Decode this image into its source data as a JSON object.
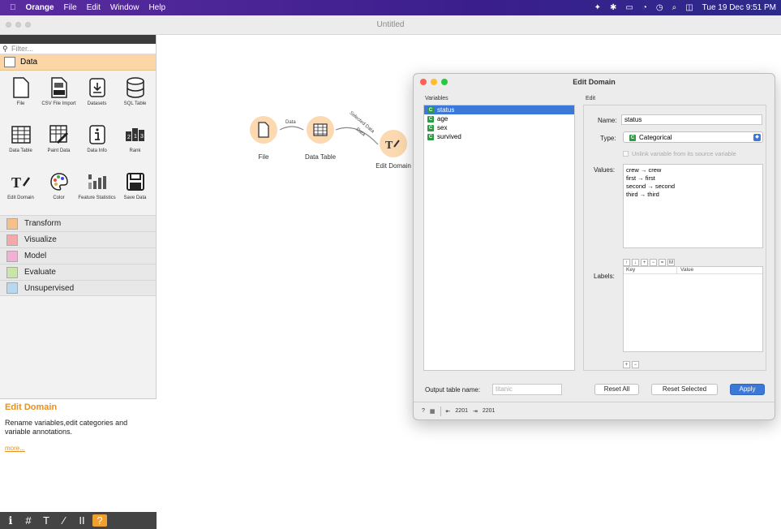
{
  "menubar": {
    "apple": "",
    "app_name": "Orange",
    "menus": [
      "File",
      "Edit",
      "Window",
      "Help"
    ],
    "status_icons": [
      "✦",
      "✱",
      "▭",
      "◔",
      "◷",
      "⌕",
      "◫"
    ],
    "datetime": "Tue 19 Dec 9:51 PM"
  },
  "window": {
    "title": "Untitled"
  },
  "sidebar": {
    "filter_placeholder": "Filter...",
    "data_category": "Data",
    "widgets": [
      {
        "label": "File",
        "icon": "file-icon"
      },
      {
        "label": "CSV File Import",
        "icon": "csv-icon"
      },
      {
        "label": "Datasets",
        "icon": "datasets-icon"
      },
      {
        "label": "SQL Table",
        "icon": "database-icon"
      },
      {
        "label": "Data Table",
        "icon": "table-icon"
      },
      {
        "label": "Paint Data",
        "icon": "paint-data-icon"
      },
      {
        "label": "Data Info",
        "icon": "info-icon"
      },
      {
        "label": "Rank",
        "icon": "rank-icon"
      },
      {
        "label": "Edit Domain",
        "icon": "edit-domain-icon"
      },
      {
        "label": "Color",
        "icon": "palette-icon"
      },
      {
        "label": "Feature Statistics",
        "icon": "bar-chart-icon"
      },
      {
        "label": "Save Data",
        "icon": "save-icon"
      }
    ],
    "categories": [
      {
        "label": "Transform",
        "color": "#f7c08a"
      },
      {
        "label": "Visualize",
        "color": "#f5a8a8"
      },
      {
        "label": "Model",
        "color": "#f0b0d8"
      },
      {
        "label": "Evaluate",
        "color": "#c8e6a8"
      },
      {
        "label": "Unsupervised",
        "color": "#b8d8f0"
      }
    ],
    "help": {
      "title": "Edit Domain",
      "text": "Rename variables,edit categories and variable annotations.",
      "more": "more..."
    },
    "bottom_icons": [
      "ℹ",
      "#",
      "T",
      "⁄",
      "II",
      "?"
    ]
  },
  "canvas": {
    "nodes": [
      "File",
      "Data Table",
      "Edit Domain"
    ],
    "links": [
      "Data",
      "Selected Data",
      "Data"
    ]
  },
  "dialog": {
    "title": "Edit Domain",
    "variables_header": "Variables",
    "edit_header": "Edit",
    "variables": [
      {
        "name": "status",
        "type": "C"
      },
      {
        "name": "age",
        "type": "C"
      },
      {
        "name": "sex",
        "type": "C"
      },
      {
        "name": "survived",
        "type": "C"
      }
    ],
    "name_label": "Name:",
    "name_value": "status",
    "type_label": "Type:",
    "type_value": "Categorical",
    "unlink_label": "Unlink variable from its source variable",
    "values_label": "Values:",
    "values": [
      "crew → crew",
      "first → first",
      "second → second",
      "third → third"
    ],
    "value_buttons": [
      "↑",
      "↓",
      "+",
      "−",
      "=",
      "M"
    ],
    "labels_label": "Labels:",
    "labels_columns": [
      "Key",
      "Value"
    ],
    "label_buttons": [
      "+",
      "−"
    ],
    "output_label": "Output table name:",
    "output_placeholder": "titanic",
    "reset_all": "Reset All",
    "reset_selected": "Reset Selected",
    "apply": "Apply",
    "status_in": "2201",
    "status_out": "2201",
    "accent": "#3b78d8"
  }
}
